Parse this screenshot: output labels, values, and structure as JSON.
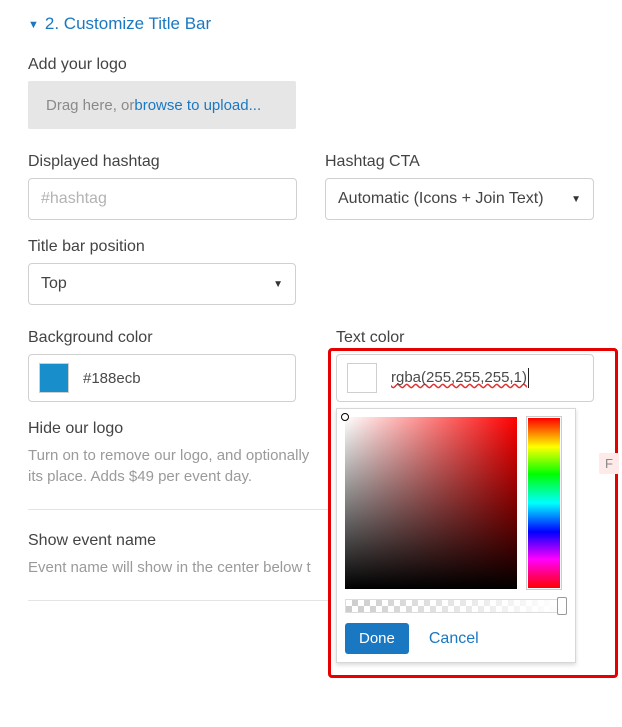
{
  "section": {
    "title": "2. Customize Title Bar"
  },
  "logo": {
    "label": "Add your logo",
    "drag_text": "Drag here, or ",
    "browse_text": "browse to upload..."
  },
  "hashtag": {
    "label": "Displayed hashtag",
    "placeholder": "#hashtag"
  },
  "cta": {
    "label": "Hashtag CTA",
    "value": "Automatic (Icons + Join Text)"
  },
  "position": {
    "label": "Title bar position",
    "value": "Top"
  },
  "bg_color": {
    "label": "Background color",
    "value": "#188ecb"
  },
  "text_color": {
    "label": "Text color",
    "value": "rgba(255,255,255,1)"
  },
  "hide_logo": {
    "label": "Hide our logo",
    "desc_part1": "Turn on to remove our logo, and optionally ",
    "desc_part2": "its place. Adds $49 per event day."
  },
  "show_name": {
    "label": "Show event name",
    "desc": "Event name will show in the center below t"
  },
  "picker": {
    "done": "Done",
    "cancel": "Cancel"
  },
  "off_chip": "F"
}
